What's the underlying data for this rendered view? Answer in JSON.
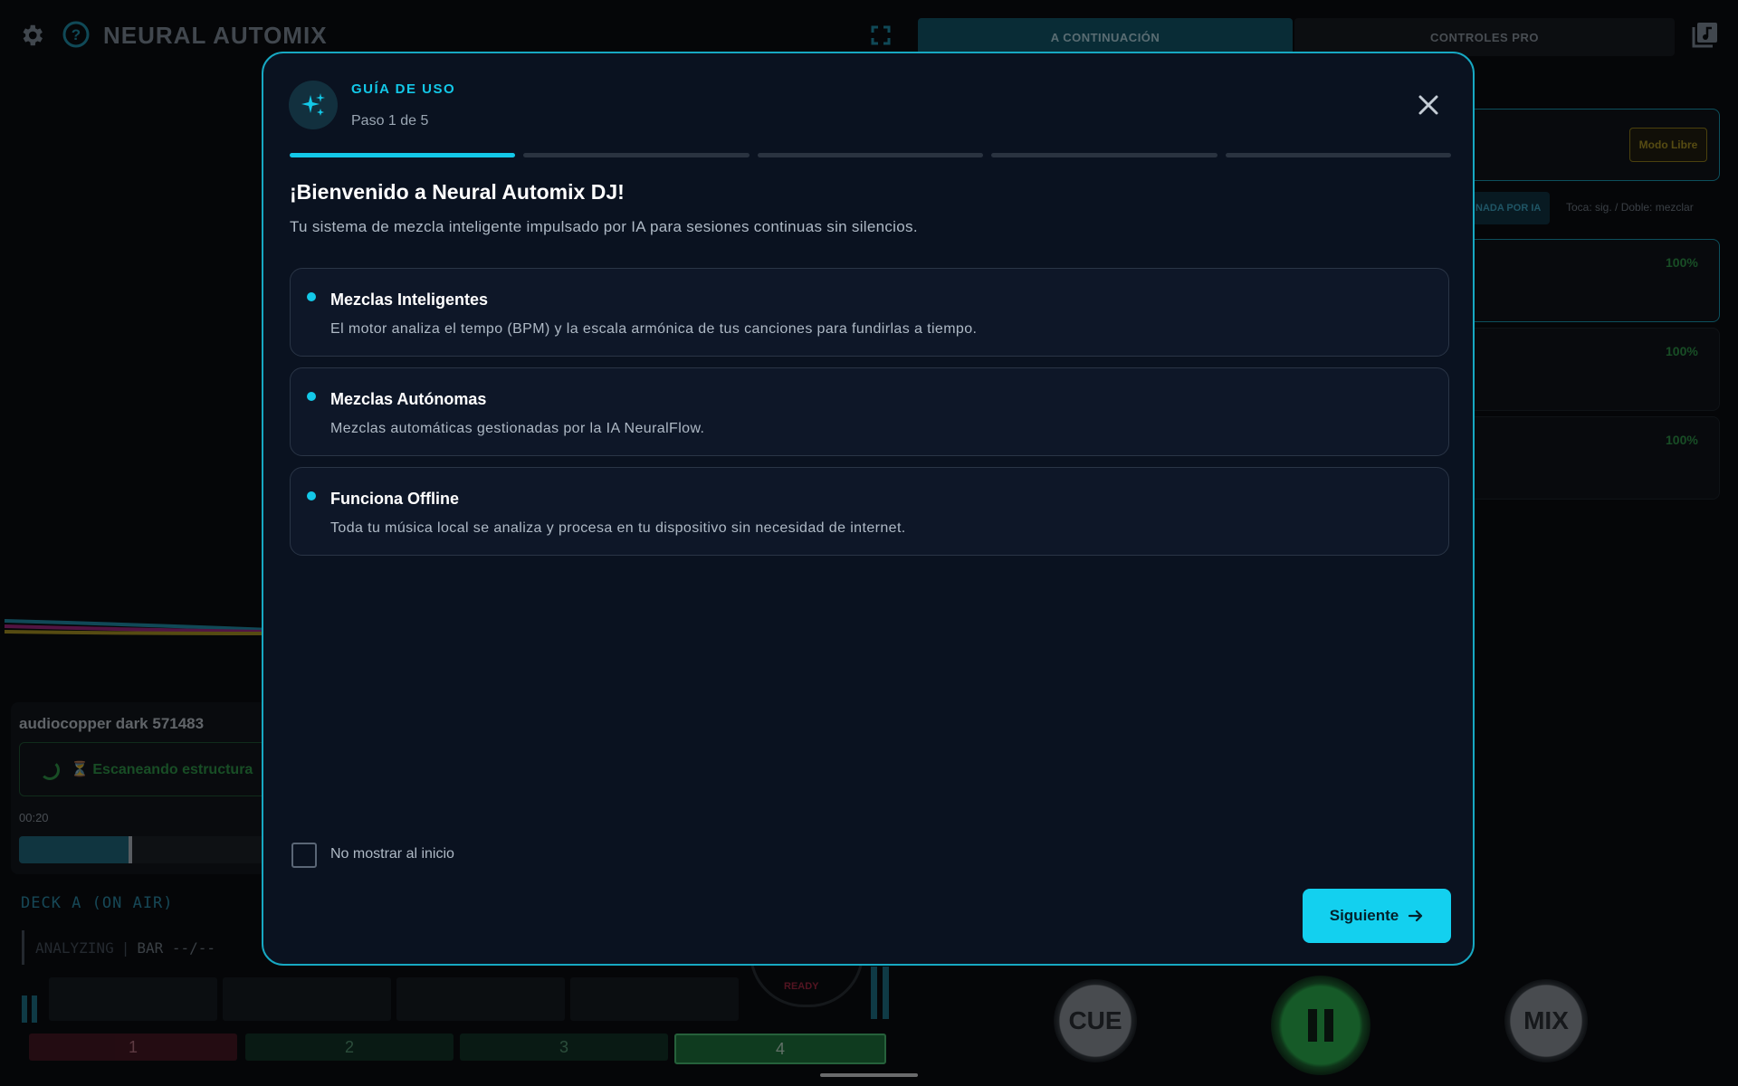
{
  "app": {
    "title": "NEURAL AUTOMIX",
    "tabs": [
      {
        "label": "A CONTINUACIÓN",
        "active": true
      },
      {
        "label": "CONTROLES PRO",
        "active": false
      }
    ]
  },
  "right_panel": {
    "mode_button": "Modo Libre",
    "ai_chip": "NADA POR IA",
    "hint": "Toca: sig. / Doble: mezclar",
    "queue_percentages": [
      "100%",
      "100%",
      "100%"
    ]
  },
  "deck": {
    "track_name": "audiocopper dark 571483",
    "status": "⏳ Escaneando estructura",
    "elapsed": "00:20",
    "progress": 0.44,
    "label": "DECK A (ON AIR)",
    "analyzing": "ANALYZING",
    "bar": "BAR --/--",
    "hotcues": [
      "1",
      "2",
      "3",
      "4"
    ],
    "jog_status": "READY"
  },
  "transport": {
    "cue": "CUE",
    "mix": "MIX"
  },
  "modal": {
    "kicker": "GUÍA DE USO",
    "step_text": "Paso 1 de 5",
    "current_step": 1,
    "total_steps": 5,
    "title": "¡Bienvenido a Neural Automix DJ!",
    "subtitle": "Tu sistema de mezcla inteligente impulsado por IA para sesiones continuas sin silencios.",
    "features": [
      {
        "title": "Mezclas Inteligentes",
        "desc": "El motor analiza el tempo (BPM) y la escala armónica de tus canciones para fundirlas a tiempo."
      },
      {
        "title": "Mezclas Autónomas",
        "desc": "Mezclas automáticas gestionadas por la IA NeuralFlow."
      },
      {
        "title": "Funciona Offline",
        "desc": "Toda tu música local se analiza y procesa en tu dispositivo sin necesidad de internet."
      }
    ],
    "checkbox_label": "No mostrar al inicio",
    "checkbox_checked": false,
    "next_label": "Siguiente"
  },
  "colors": {
    "accent": "#13c8e8",
    "modal_bg": "#0a1220",
    "green": "#2fa34a"
  }
}
